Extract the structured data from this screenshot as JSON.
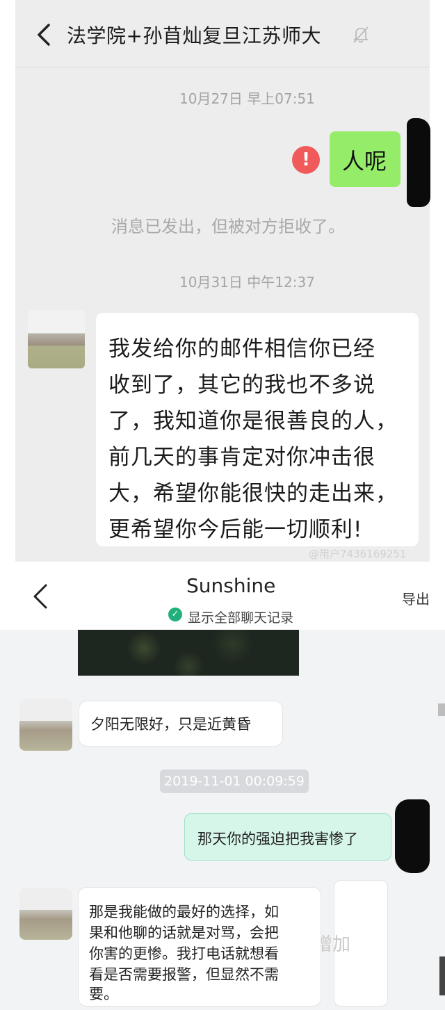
{
  "chat1": {
    "title": "法学院+孙苜灿复旦江苏师大",
    "messages": {
      "ts1": "10月27日 早上07:51",
      "sent_text": "人呢",
      "error_mark": "!",
      "system_notice": "消息已发出，但被对方拒收了。",
      "ts2": "10月31日 中午12:37",
      "received_lines": [
        "我发给你的邮件相信你已经",
        "收到了，其它的我也不多说",
        "了，我知道你是很善良的人，",
        "前几天的事肯定对你冲击很",
        "大，希望你能很快的走出来，",
        "更希望你今后能一切顺利!"
      ]
    },
    "watermark": "@用户7436169251",
    "icons": [
      "back-chevron-icon",
      "mute-bell-icon",
      "error-icon"
    ]
  },
  "chat2": {
    "title": "Sunshine",
    "show_all": "显示全部聊天记录",
    "export": "导出",
    "messages": {
      "m1": "夕阳无限好，只是近黄昏",
      "timestamp": "2019-11-01 00:09:59",
      "m2": "那天你的强迫把我害惨了",
      "m3_lines": [
        "那是我能做的最好的选择，如",
        "果和他聊的话就是对骂，会把",
        "你害的更惨。我打电话就想看",
        "看是否需要报警，但显然不需",
        "要。"
      ],
      "ghost_text": "增加"
    },
    "icons": [
      "back-chevron-icon",
      "check-circle-icon"
    ]
  }
}
